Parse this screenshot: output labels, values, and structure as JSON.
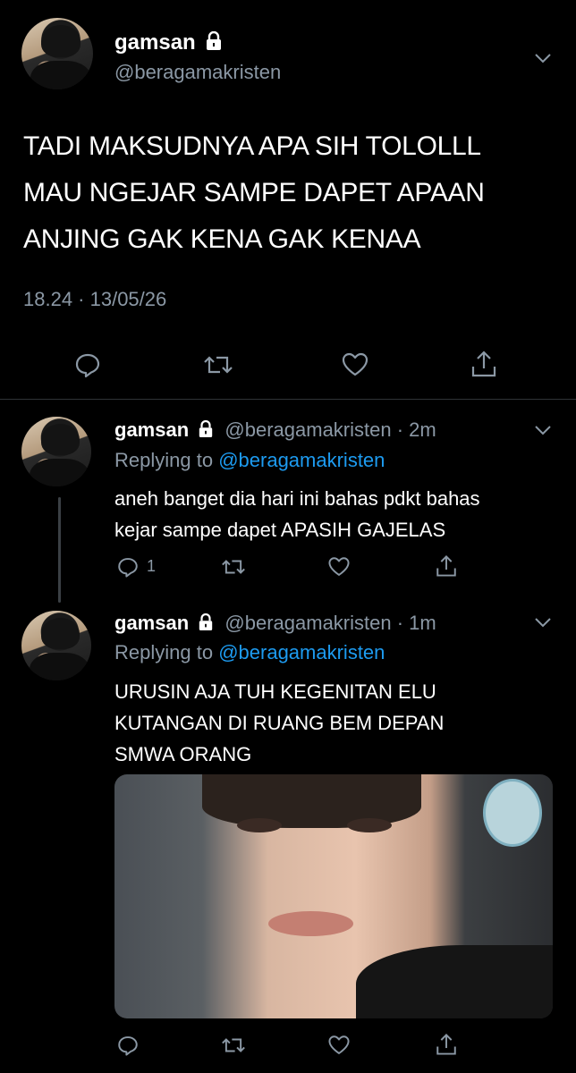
{
  "main_tweet": {
    "display_name": "gamsan",
    "handle": "@beragamakristen",
    "text_lines": [
      "TADI MAKSUDNYA APA SIH TOLOLLL",
      "MAU NGEJAR SAMPE DAPET APAAN",
      "ANJING GAK KENA GAK KENAA"
    ],
    "timestamp": "18.24 · 13/05/26",
    "icons": [
      "reply-icon",
      "retweet-icon",
      "like-icon",
      "share-icon"
    ]
  },
  "replies": [
    {
      "display_name": "gamsan",
      "handle_time": "@beragamakristen · 2m",
      "replying_prefix": "Replying to",
      "replying_to": "@beragamakristen",
      "text_lines": [
        "aneh banget dia hari ini bahas pdkt bahas",
        "kejar sampe dapet APASIH GAJELAS"
      ],
      "reply_count": "1"
    },
    {
      "display_name": "gamsan",
      "handle_time": "@beragamakristen · 1m",
      "replying_prefix": "Replying to",
      "replying_to": "@beragamakristen",
      "text_lines": [
        "URUSIN AJA TUH KEGENITAN ELU",
        "KUTANGAN DI RUANG BEM DEPAN",
        "SMWA ORANG"
      ],
      "reply_count": ""
    }
  ],
  "colors": {
    "background": "#000000",
    "muted": "#8b98a5",
    "link": "#1d9bf0",
    "divider": "#2f3336"
  }
}
